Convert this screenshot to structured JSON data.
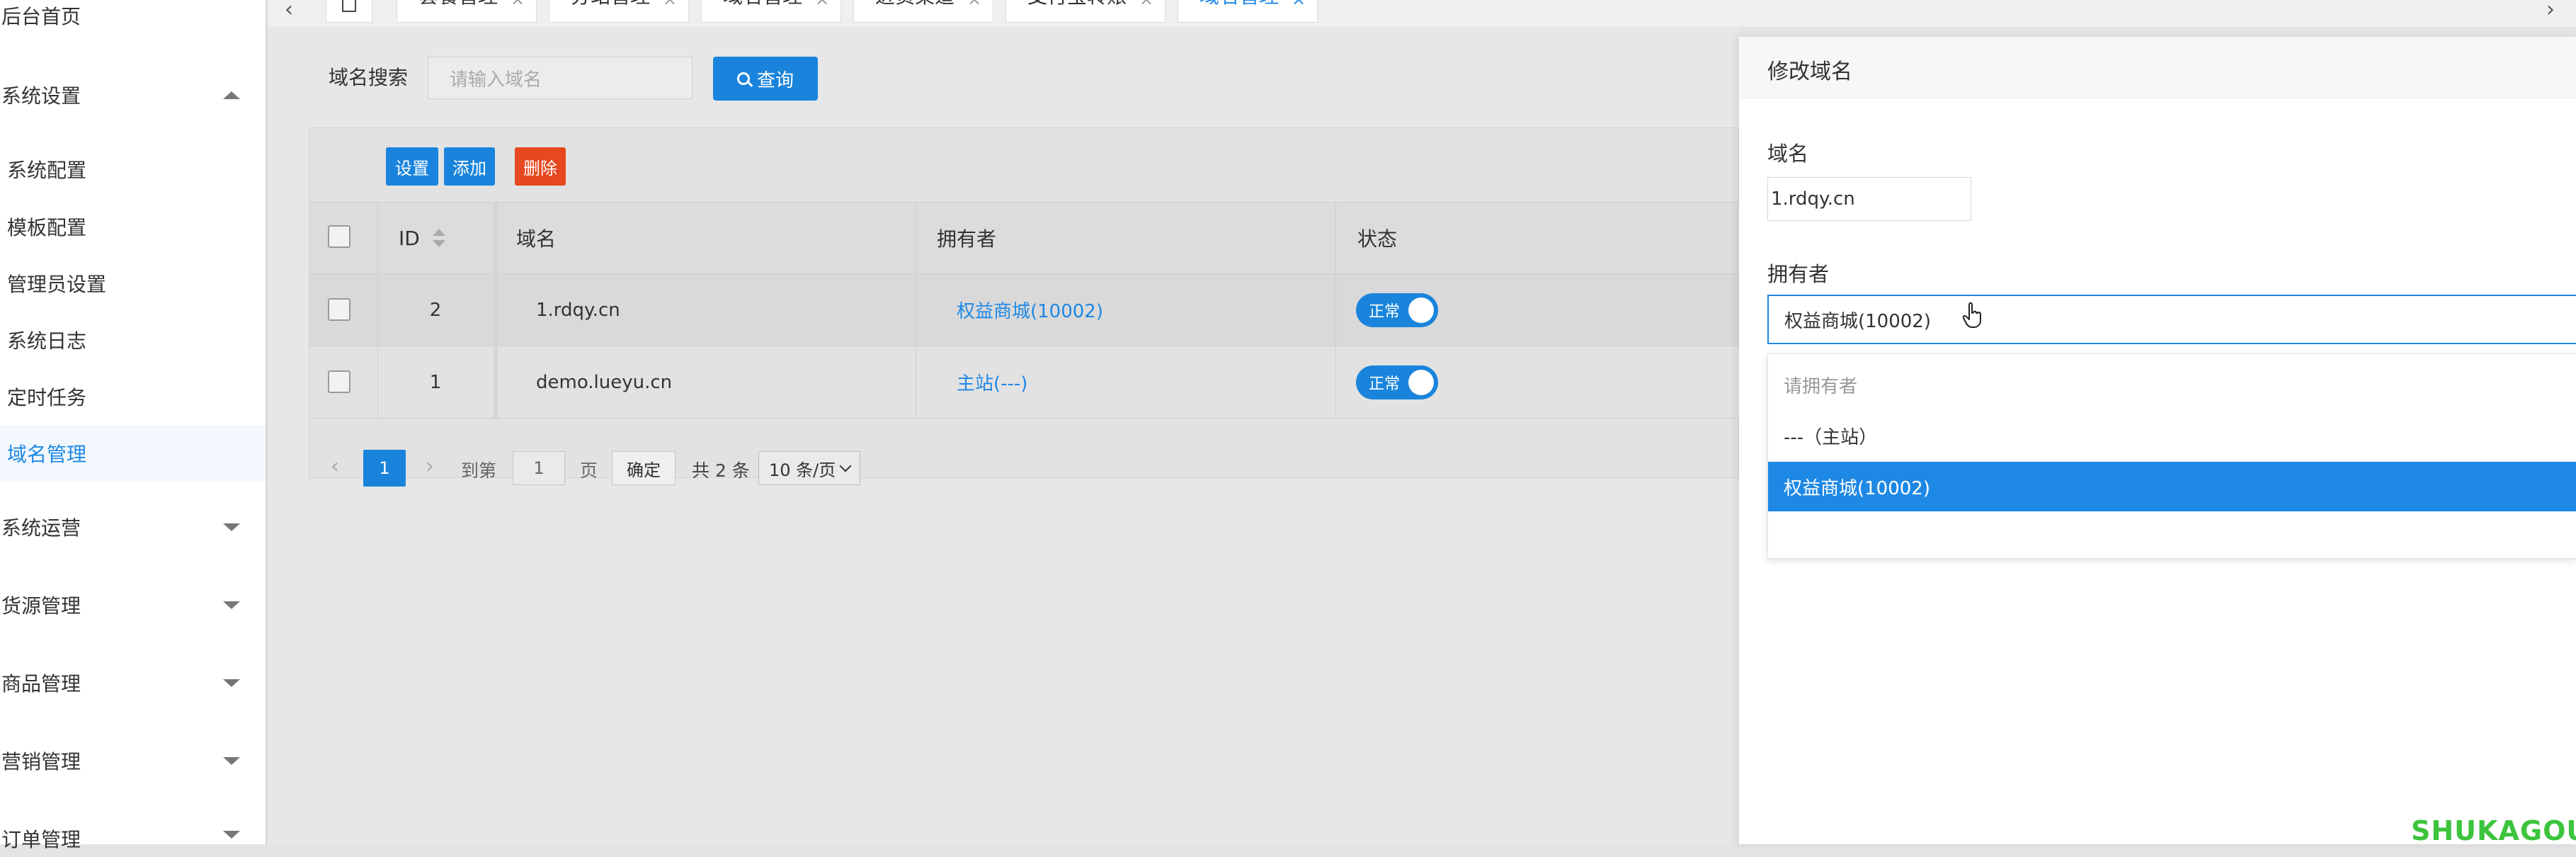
{
  "sidebar": {
    "home": "后台首页",
    "system_settings": "系统设置",
    "sub_items": [
      "系统配置",
      "模板配置",
      "管理员设置",
      "系统日志",
      "定时任务",
      "域名管理"
    ],
    "groups": [
      "系统运营",
      "货源管理",
      "商品管理",
      "营销管理",
      "订单管理"
    ]
  },
  "tabbar": {
    "prev": "‹",
    "next": "›",
    "home_icon": "home-icon",
    "tabs": [
      {
        "label": "套餐管理",
        "close": "×"
      },
      {
        "label": "分站管理",
        "close": "×"
      },
      {
        "label": "域名管理",
        "close": "×"
      },
      {
        "label": "进货渠道",
        "close": "×"
      },
      {
        "label": "支付宝转账",
        "close": "×"
      },
      {
        "label": "域名管理",
        "close": "×",
        "active": true
      }
    ]
  },
  "search": {
    "label": "域名搜索",
    "placeholder": "请输入域名",
    "button": "查询"
  },
  "toolbar": {
    "settings": "设置",
    "add": "添加",
    "delete": "删除"
  },
  "table": {
    "headers": [
      "ID",
      "域名",
      "拥有者",
      "状态"
    ],
    "rows": [
      {
        "id": "2",
        "domain": "1.rdqy.cn",
        "owner": "权益商城(10002)",
        "status": "正常"
      },
      {
        "id": "1",
        "domain": "demo.lueyu.cn",
        "owner": "主站(---)",
        "status": "正常"
      }
    ]
  },
  "pager": {
    "prev": "‹",
    "next": "›",
    "current": "1",
    "goto_label": "到第",
    "page_value": "1",
    "page_unit": "页",
    "confirm": "确定",
    "total": "共 2 条",
    "page_size": "10 条/页"
  },
  "drawer": {
    "title": "修改域名",
    "domain_label": "域名",
    "domain_value": "1.rdqy.cn",
    "owner_label": "拥有者",
    "owner_value": "权益商城(10002)",
    "options": [
      {
        "label": "请拥有者",
        "placeholder": true
      },
      {
        "label": "---（主站）"
      },
      {
        "label": "权益商城(10002)",
        "selected": true
      }
    ]
  },
  "watermark": "SHUKAGOU",
  "colors": {
    "accent": "#1e88e5",
    "danger": "#e6481f",
    "watermark": "#3cc43c"
  }
}
